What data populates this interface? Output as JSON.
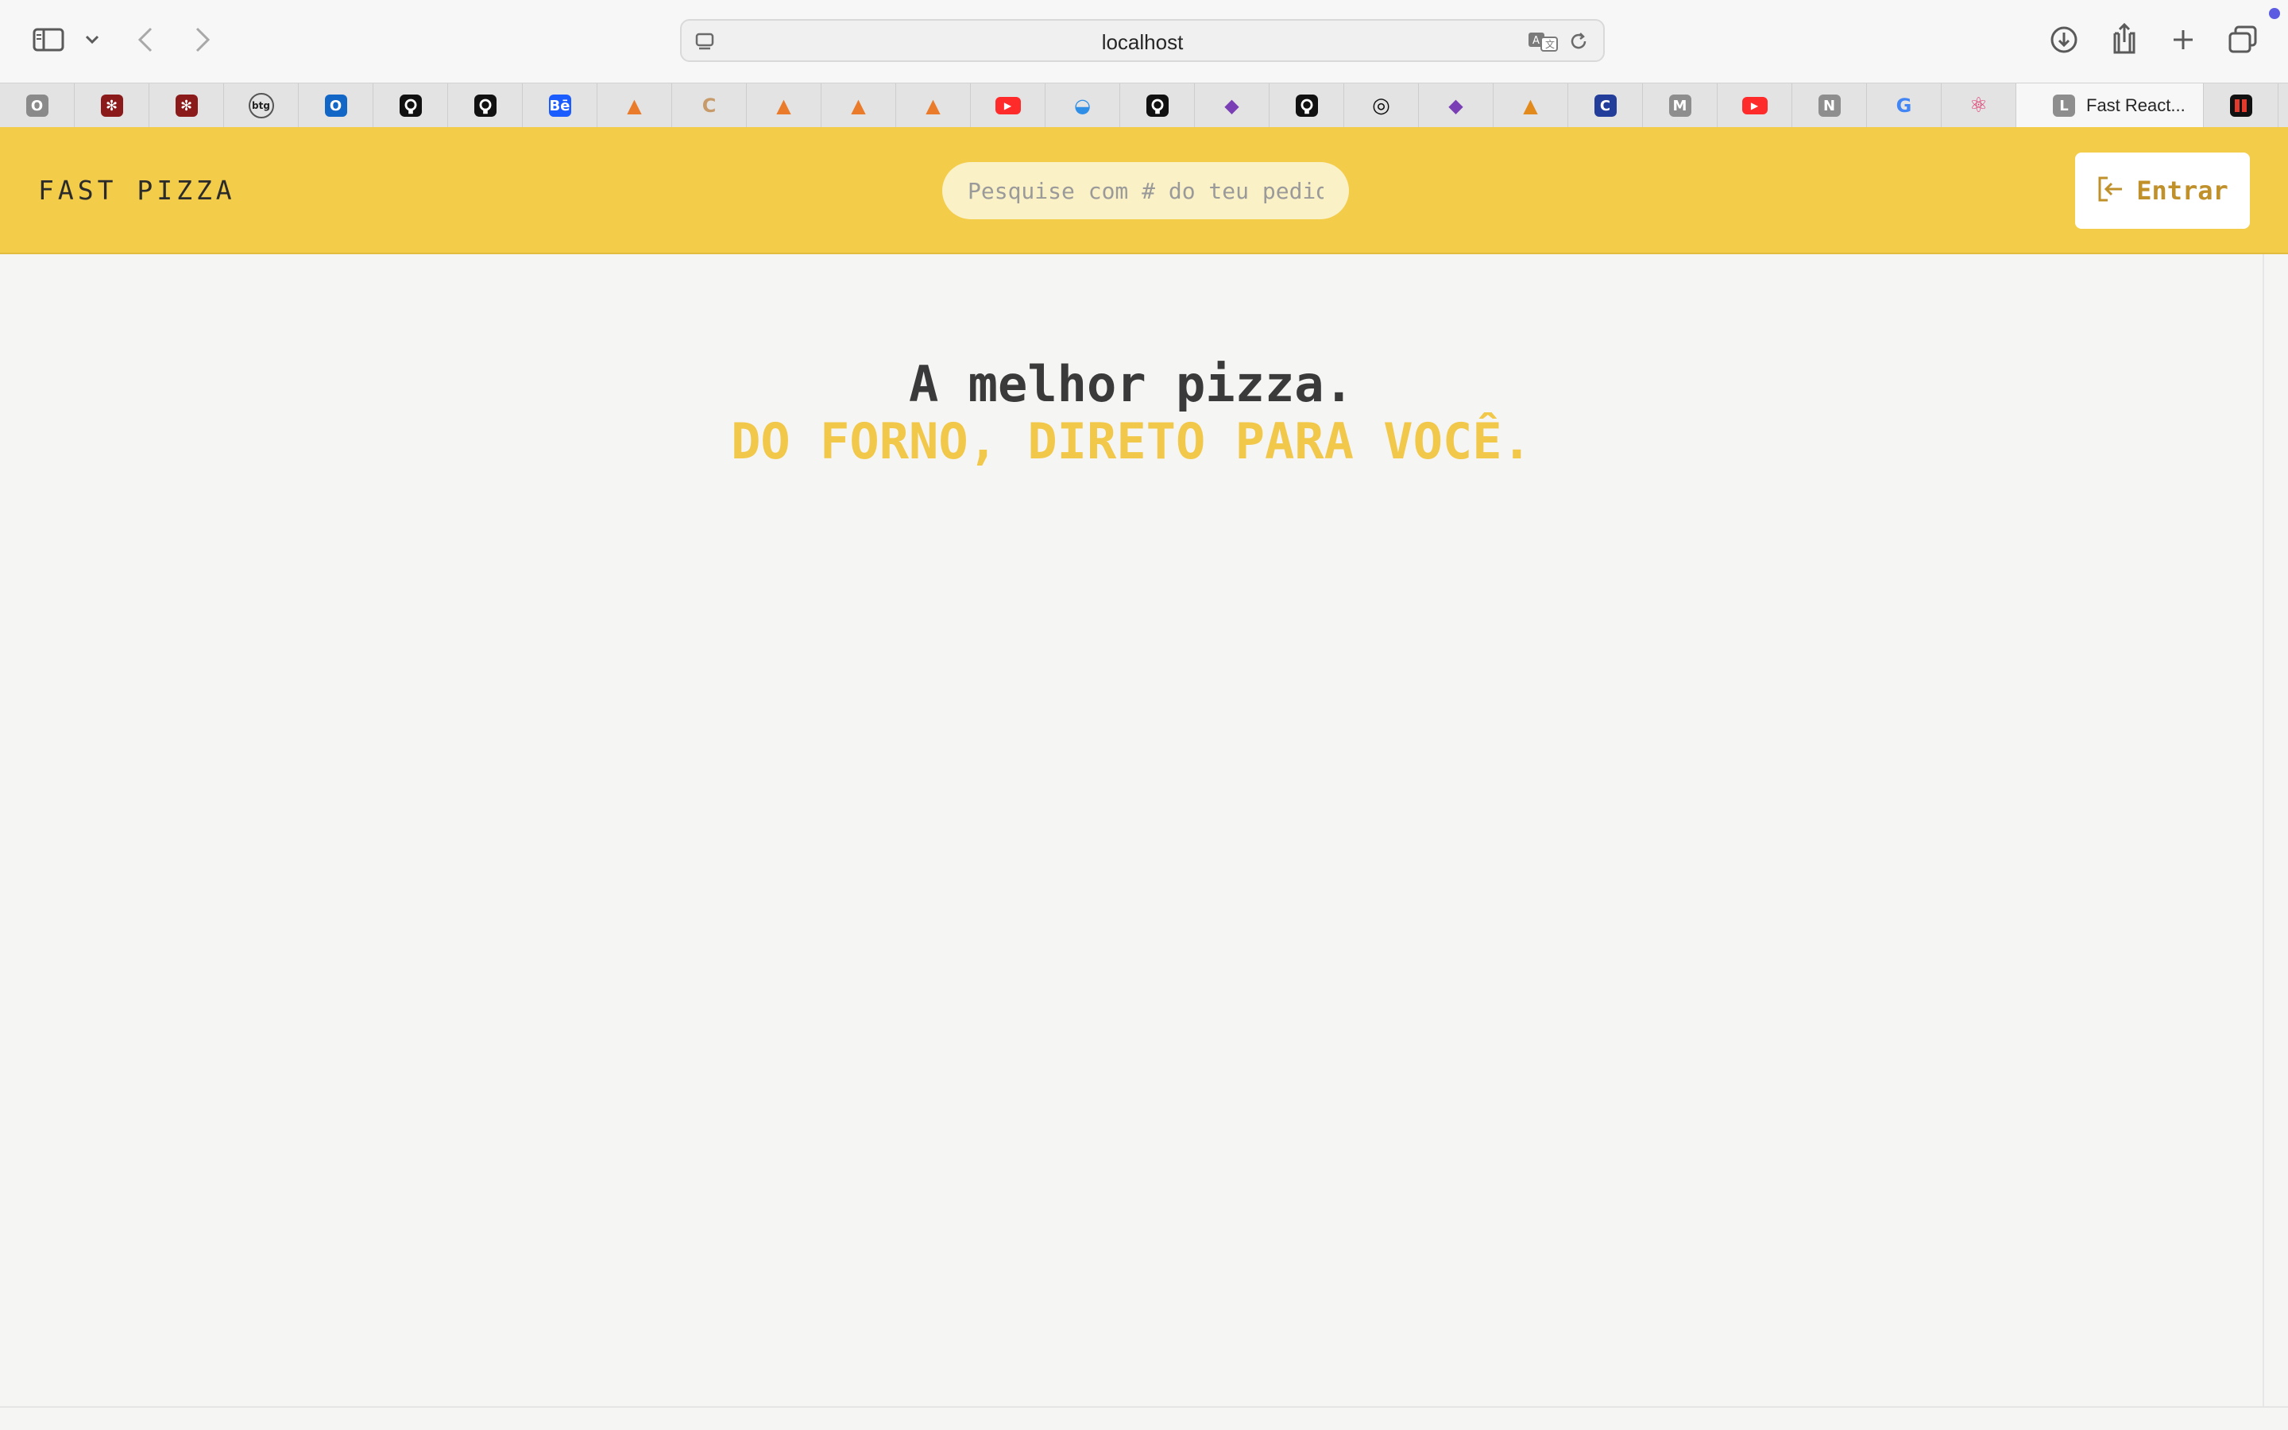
{
  "browser": {
    "url": "localhost",
    "active_tab_title": "Fast React...",
    "tabs": [
      {
        "icon": "o-icon",
        "letter": "O",
        "color": "#8a8a8a"
      },
      {
        "icon": "snowflake-icon",
        "letter": "✻",
        "color": "#8b1a1a"
      },
      {
        "icon": "snowflake-icon",
        "letter": "✻",
        "color": "#8b1a1a"
      },
      {
        "icon": "btg-icon",
        "letter": "btg",
        "color": "#ffffff"
      },
      {
        "icon": "outlook-icon",
        "letter": "O",
        "color": "#1266c6"
      },
      {
        "icon": "github-icon",
        "letter": "●",
        "color": "#111111"
      },
      {
        "icon": "github-icon",
        "letter": "●",
        "color": "#111111"
      },
      {
        "icon": "behance-icon",
        "letter": "Bē",
        "color": "#1b5cff"
      },
      {
        "icon": "carrot-icon",
        "letter": "▲",
        "color": "#ea7b2b"
      },
      {
        "icon": "c-icon",
        "letter": "C",
        "color": "#c79a6a"
      },
      {
        "icon": "carrot-icon",
        "letter": "▲",
        "color": "#ea7b2b"
      },
      {
        "icon": "carrot-icon",
        "letter": "▲",
        "color": "#ea7b2b"
      },
      {
        "icon": "carrot-icon",
        "letter": "▲",
        "color": "#ea7b2b"
      },
      {
        "icon": "youtube-icon",
        "letter": "▶",
        "color": "#ff2a2a"
      },
      {
        "icon": "docker-icon",
        "letter": "◒",
        "color": "#2f8ee6"
      },
      {
        "icon": "github-icon",
        "letter": "●",
        "color": "#111111"
      },
      {
        "icon": "stack-icon",
        "letter": "◆",
        "color": "#7b3fb5"
      },
      {
        "icon": "github-icon",
        "letter": "●",
        "color": "#111111"
      },
      {
        "icon": "openai-icon",
        "letter": "◎",
        "color": "#111111"
      },
      {
        "icon": "stack-icon",
        "letter": "◆",
        "color": "#7b3fb5"
      },
      {
        "icon": "pma-icon",
        "letter": "▲",
        "color": "#e28a1c"
      },
      {
        "icon": "cf-icon",
        "letter": "C",
        "color": "#233d9b"
      },
      {
        "icon": "m-icon",
        "letter": "M",
        "color": "#8e8e8e"
      },
      {
        "icon": "youtube-icon",
        "letter": "▶",
        "color": "#ff2a2a"
      },
      {
        "icon": "n-icon",
        "letter": "N",
        "color": "#8e8e8e"
      },
      {
        "icon": "google-icon",
        "letter": "G",
        "color": "#ffffff"
      },
      {
        "icon": "react-icon",
        "letter": "⚛",
        "color": "#ffffff"
      }
    ],
    "active_tab_icon_letter": "L",
    "last_tab_icon": "tiles-icon"
  },
  "app": {
    "logo": "FAST PIZZA",
    "search_placeholder": "Pesquise com # do teu pedido",
    "login_label": "Entrar",
    "hero_line1": "A melhor pizza.",
    "hero_line2": "DO FORNO, DIRETO PARA VOCÊ."
  },
  "colors": {
    "header_bg": "#f3cc4a",
    "accent": "#f2c84a",
    "login_text": "#c0902a"
  }
}
